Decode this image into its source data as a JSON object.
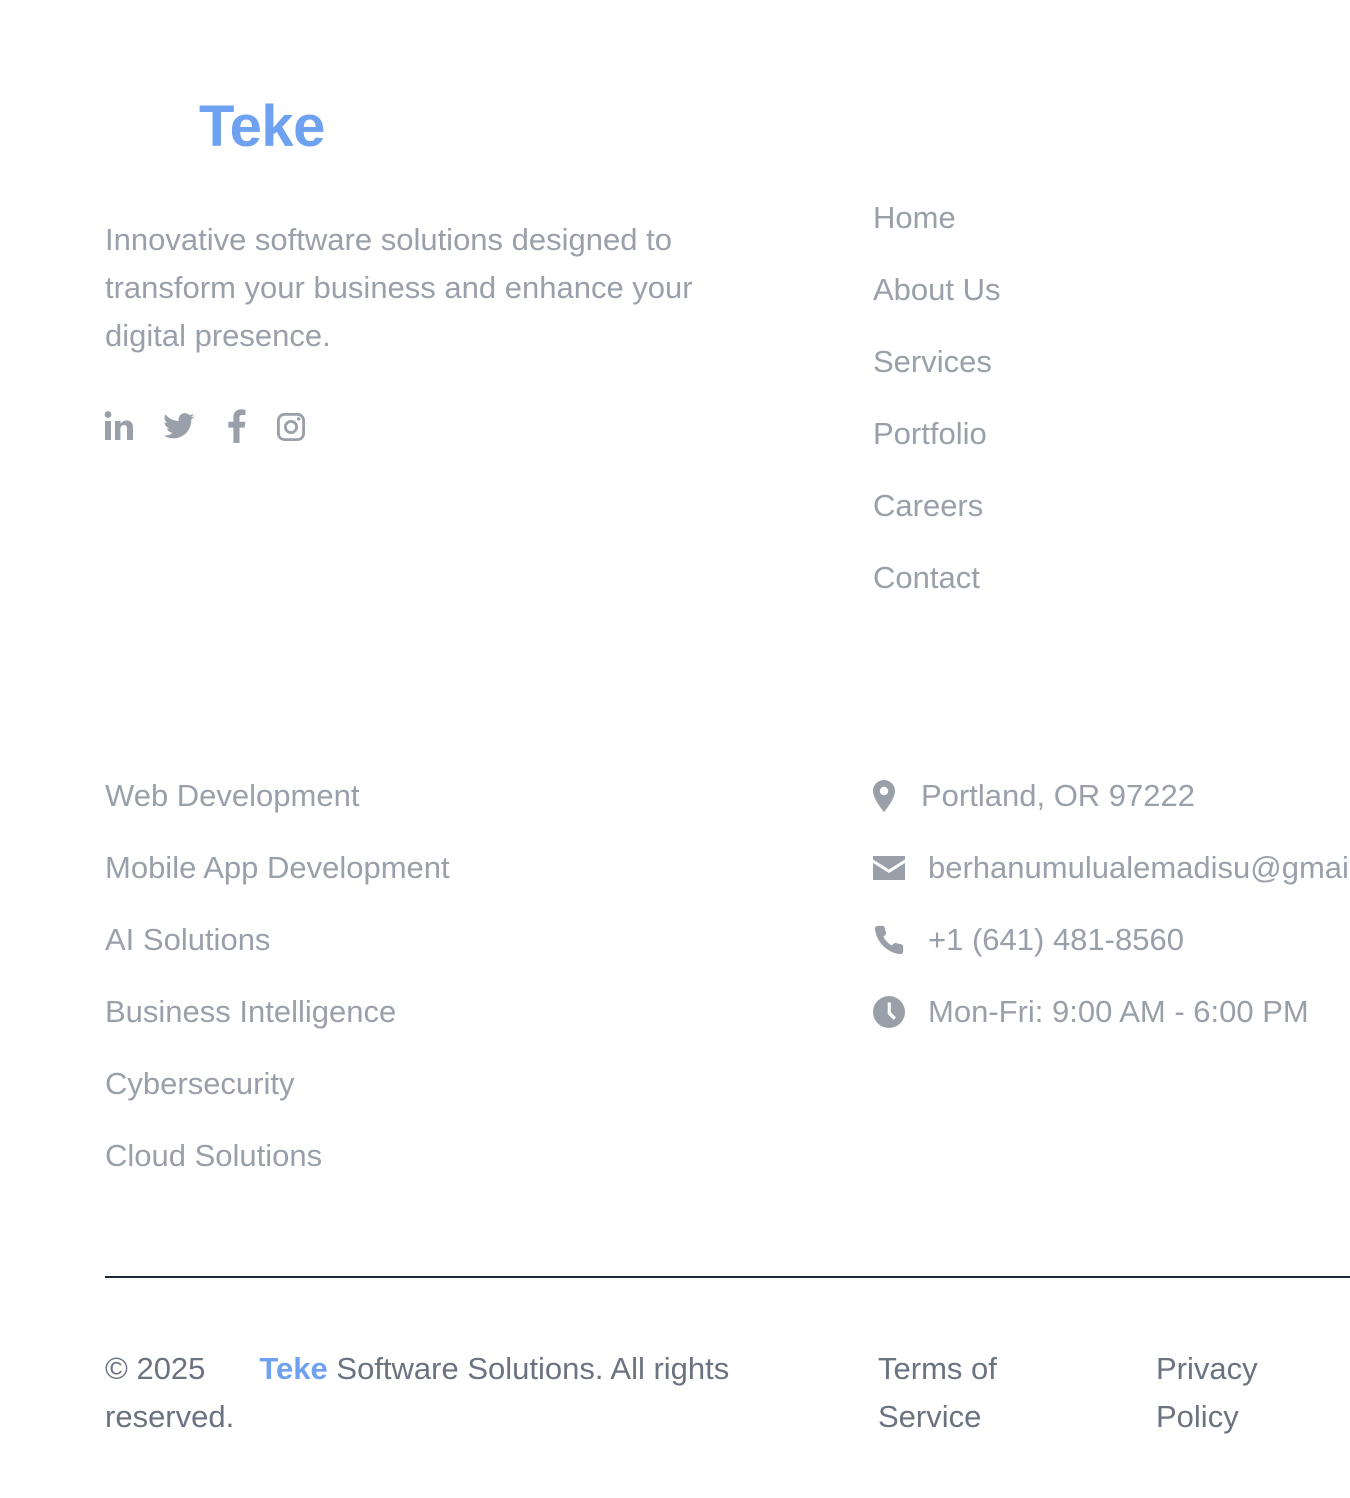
{
  "brand": {
    "name": "Teke",
    "tagline": "Innovative software solutions designed to transform your business and enhance your digital presence."
  },
  "social": [
    {
      "icon": "linkedin-icon"
    },
    {
      "icon": "twitter-icon"
    },
    {
      "icon": "facebook-icon"
    },
    {
      "icon": "instagram-icon"
    }
  ],
  "nav": {
    "items": [
      {
        "label": "Home"
      },
      {
        "label": "About Us"
      },
      {
        "label": "Services"
      },
      {
        "label": "Portfolio"
      },
      {
        "label": "Careers"
      },
      {
        "label": "Contact"
      }
    ]
  },
  "services": {
    "items": [
      {
        "label": "Web Development"
      },
      {
        "label": "Mobile App Development"
      },
      {
        "label": "AI Solutions"
      },
      {
        "label": "Business Intelligence"
      },
      {
        "label": "Cybersecurity"
      },
      {
        "label": "Cloud Solutions"
      }
    ]
  },
  "contact": {
    "items": [
      {
        "icon": "map-pin-icon",
        "text": "Portland, OR 97222"
      },
      {
        "icon": "envelope-icon",
        "text": "berhanumulualemadisu@gmail.com"
      },
      {
        "icon": "phone-icon",
        "text": "+1 (641) 481-8560"
      },
      {
        "icon": "clock-icon",
        "text": "Mon-Fri: 9:00 AM - 6:00 PM"
      }
    ]
  },
  "footer": {
    "copyright_prefix": "© 2025",
    "brand_name": "Teke",
    "copyright_suffix": "Software Solutions. All rights reserved.",
    "terms_label": "Terms of Service",
    "privacy_label": "Privacy Policy"
  },
  "colors": {
    "brand": "#6ea1ef",
    "muted_text": "#9aa0aa",
    "footer_text": "#6b7280",
    "divider": "#1f2933"
  }
}
